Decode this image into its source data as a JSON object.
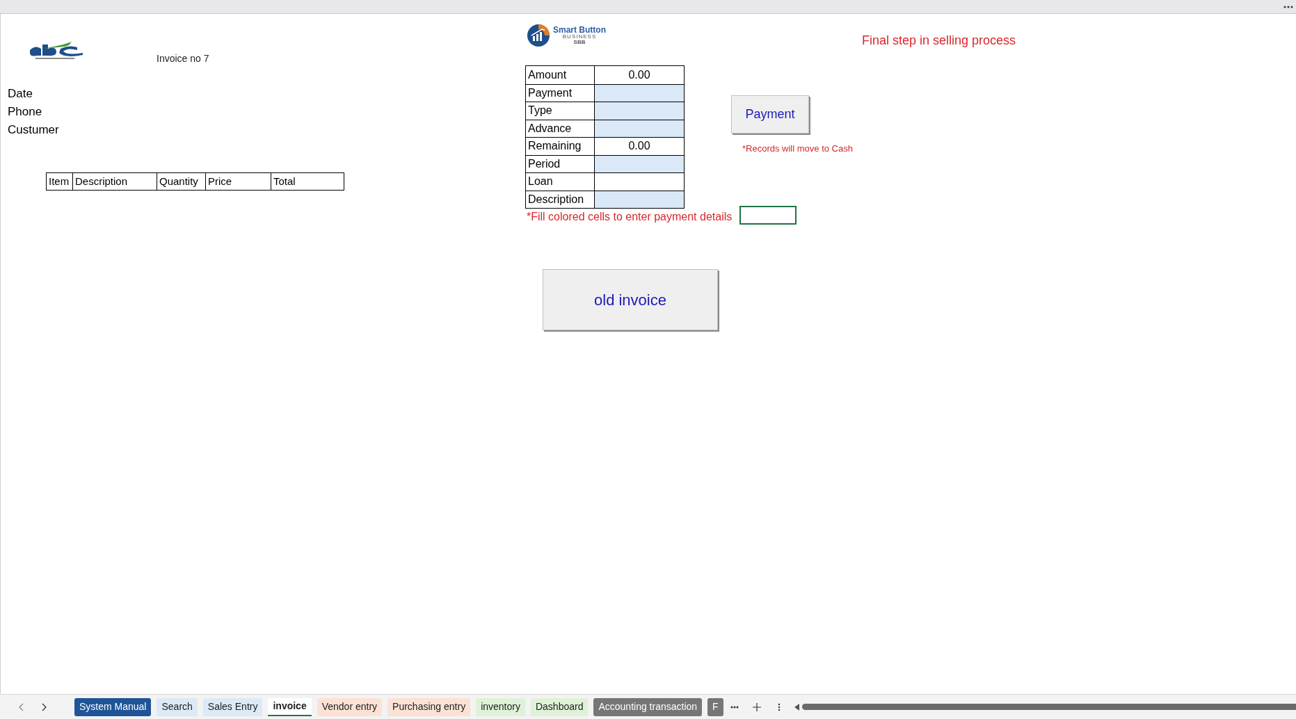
{
  "invoice": {
    "number": "Invoice no 7",
    "fields": [
      "Date",
      "Phone",
      "Custumer"
    ],
    "columns": [
      "Item",
      "Description",
      "Quantity",
      "Price",
      "Total"
    ]
  },
  "smart_logo": {
    "name": "Smart Button",
    "tagline": "BUSINESS",
    "short": "SBB"
  },
  "headline": "Final step in selling process",
  "payment_table": [
    {
      "label": "Amount",
      "value": "0.00",
      "highlighted": false
    },
    {
      "label": "Payment",
      "highlighted": true
    },
    {
      "label": "Type",
      "highlighted": true
    },
    {
      "label": "Advance",
      "highlighted": true
    },
    {
      "label": "Remaining",
      "value": "0.00",
      "highlighted": false
    },
    {
      "label": "Period",
      "highlighted": true
    },
    {
      "label": "Loan",
      "highlighted": false
    },
    {
      "label": "Description",
      "highlighted": true
    }
  ],
  "fill_note": "*Fill colored cells to enter payment details",
  "payment_button": "Payment",
  "records_note": "*Records will move to Cash",
  "old_invoice_button": "old invoice",
  "sheet_tabs": [
    {
      "label": "System Manual",
      "color": "#1f5597",
      "selected": false
    },
    {
      "label": "Search",
      "color": "#dce9f7",
      "selected": false
    },
    {
      "label": "Sales Entry",
      "color": "#dce9f7",
      "selected": false
    },
    {
      "label": "invoice",
      "color": "#ffffff",
      "selected": true
    },
    {
      "label": "Vendor entry",
      "color": "#fbe2d5",
      "selected": false
    },
    {
      "label": "Purchasing entry",
      "color": "#fbe2d5",
      "selected": false
    },
    {
      "label": "inventory",
      "color": "#dff2d8",
      "selected": false
    },
    {
      "label": "Dashboard",
      "color": "#dff2d8",
      "selected": false
    },
    {
      "label": "Accounting transaction",
      "color": "#767676",
      "selected": false
    },
    {
      "label": "F",
      "color": "#767676",
      "selected": false
    }
  ]
}
